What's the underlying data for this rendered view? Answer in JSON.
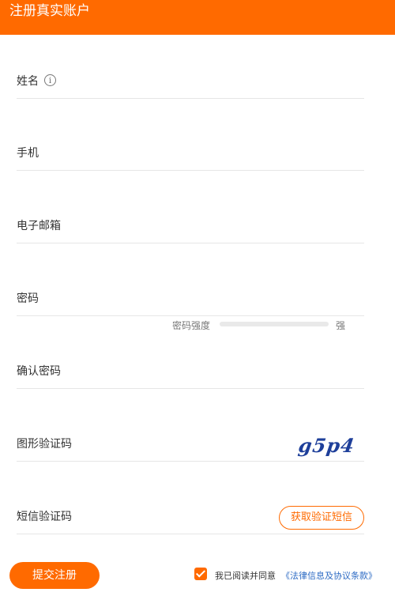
{
  "header": {
    "title": "注册真实账户"
  },
  "fields": [
    {
      "label": "姓名"
    },
    {
      "label": "手机"
    },
    {
      "label": "电子邮箱"
    },
    {
      "label": "密码"
    },
    {
      "label": "确认密码"
    },
    {
      "label": "图形验证码"
    },
    {
      "label": "短信验证码"
    }
  ],
  "password_strength": {
    "label": "密码强度",
    "max_label": "强",
    "level": 0
  },
  "captcha": {
    "text": "g5p4"
  },
  "sms_button_label": "获取验证短信",
  "submit_label": "提交注册",
  "agreement": {
    "checked": true,
    "text": "我已阅读并同意",
    "link": "《法律信息及协议条款》"
  },
  "icons": {
    "info": "info-icon",
    "checkbox": "checkbox-checked-icon"
  },
  "colors": {
    "brand": "#ff6a00",
    "link": "#2d6bc4",
    "captcha": "#1e3f9a"
  }
}
